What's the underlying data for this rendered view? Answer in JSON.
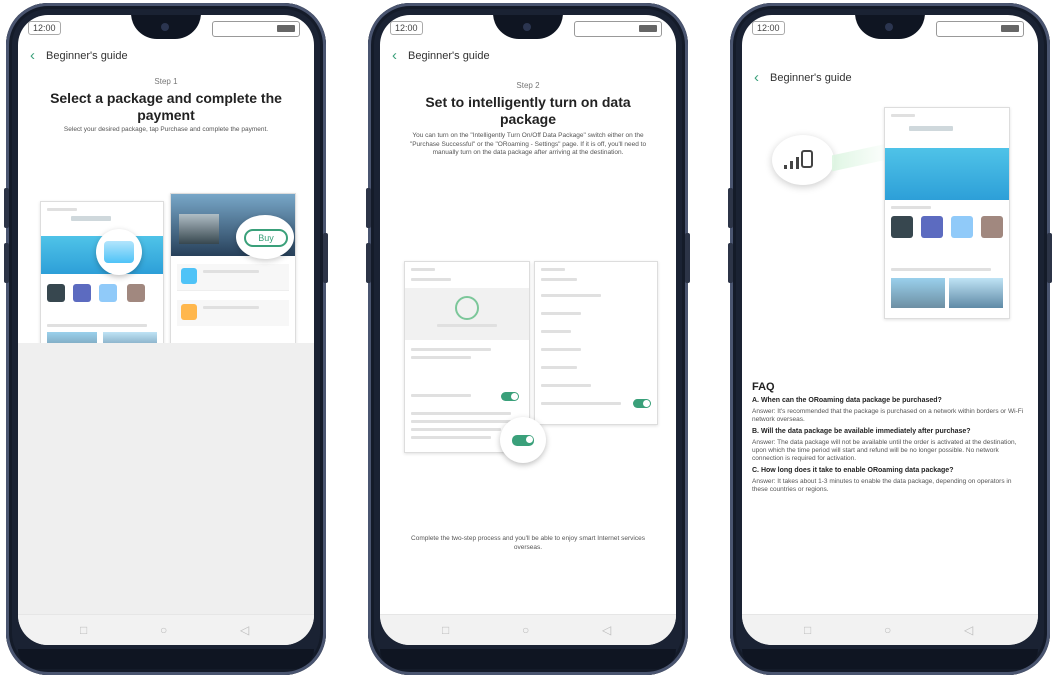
{
  "status": {
    "time": "12:00"
  },
  "screens": [
    {
      "title": "Beginner's guide",
      "step": "Step 1",
      "headline": "Select a package and complete the payment",
      "description": "Select your desired package, tap Purchase and complete the payment.",
      "buy_label": "Buy"
    },
    {
      "title": "Beginner's guide",
      "step": "Step 2",
      "headline": "Set to intelligently turn on data package",
      "description": "You can turn on the \"Intelligently Turn On/Off Data Package\" switch either on the \"Purchase Successful\" or the \"ORoaming - Settings\" page. If it is off, you'll need to manually turn on the data package after arriving at the destination.",
      "footer": "Complete the two-step process and you'll be able to enjoy smart Internet services overseas."
    },
    {
      "title": "Beginner's guide",
      "faq_title": "FAQ",
      "faq": [
        {
          "q": "A. When can the ORoaming data package be purchased?",
          "a": "Answer: It's recommended that the package is purchased on a network within borders or Wi-Fi network overseas."
        },
        {
          "q": "B. Will the data package be available immediately after purchase?",
          "a": "Answer: The data package will not be available until the order is activated at the destination, upon which the time period will start and refund will be no longer possible. No network connection is required for activation."
        },
        {
          "q": "C. How long does it take to enable ORoaming data package?",
          "a": "Answer: It takes about 1-3 minutes to enable the data package, depending on operators in these countries or regions."
        }
      ]
    }
  ],
  "nav_icons": [
    "square-icon",
    "circle-icon",
    "triangle-icon"
  ]
}
